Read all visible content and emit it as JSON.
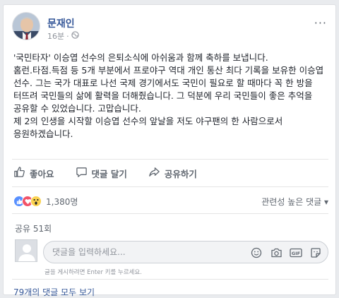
{
  "post": {
    "author": "문재인",
    "time": "16분",
    "more": "···",
    "text_lines": [
      "'국민타자' 이승엽 선수의 은퇴소식에 아쉬움과 함께 축하를 보냅니다.",
      "홈런.타점.득점 등 5개 부분에서 프로야구 역대 개인 통산 최다 기록을 보유한 이승엽 선수. 그는 국가 대표로 나선 국제 경기에서도 국민이 필요로 할 때마다 꼭 한 방을 터뜨려 국민들의 삶에 활력을 더해줬습니다. 그 덕분에 우리 국민들이 좋은 추억을 공유할 수 있었습니다. 고맙습니다.",
      "제 2의 인생을 시작할 이승엽 선수의 앞날을 저도 야구팬의 한 사람으로서 응원하겠습니다."
    ]
  },
  "actions": {
    "like": "좋아요",
    "comment": "댓글 달기",
    "share": "공유하기"
  },
  "reactions": {
    "count": "1,380명",
    "sort_label": "관련성 높은 댓글 ▾",
    "colors": {
      "like": "#5890ff",
      "love": "#f25268",
      "wow": "#fbd250"
    }
  },
  "shares": {
    "label": "공유 51회"
  },
  "comment_box": {
    "placeholder": "댓글을 입력하세요...",
    "hint": "글을 게시하려면 Enter 키를 누르세요.",
    "icons": [
      "emoji-icon",
      "camera-icon",
      "gif-icon",
      "sticker-icon"
    ]
  },
  "footer": {
    "view_all": "79개의 댓글 모두 보기"
  }
}
